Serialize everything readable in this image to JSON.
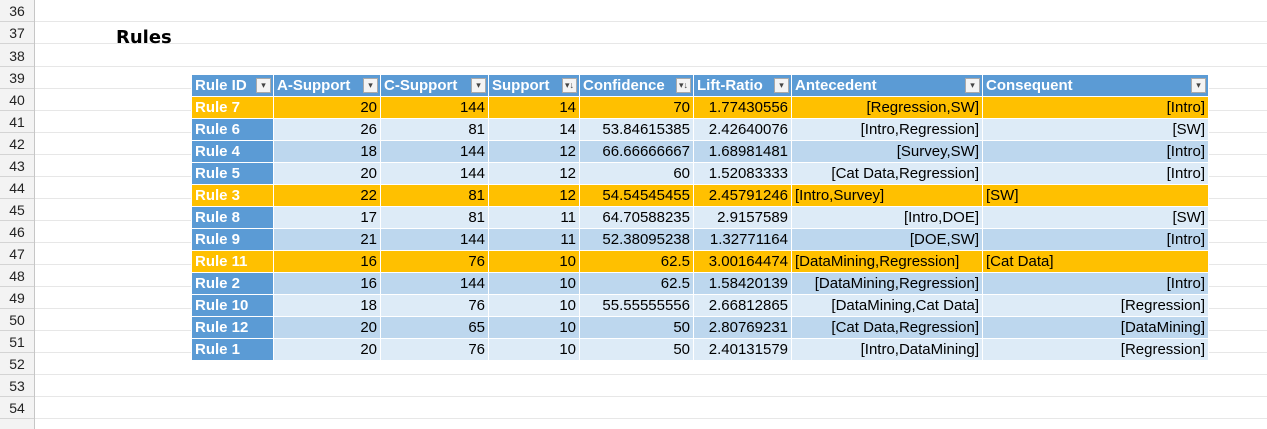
{
  "sheet": {
    "row_numbers": [
      "36",
      "37",
      "38",
      "39",
      "40",
      "41",
      "42",
      "43",
      "44",
      "45",
      "46",
      "47",
      "48",
      "49",
      "50",
      "51",
      "52",
      "53",
      "54"
    ],
    "section_title": "Rules"
  },
  "table": {
    "headers": [
      "Rule ID",
      "A-Support",
      "C-Support",
      "Support",
      "Confidence",
      "Lift-Ratio",
      "Antecedent",
      "Consequent"
    ],
    "dropdown_glyphs": [
      "▾",
      "▾",
      "▾",
      "▾↓",
      "▾↓",
      "▾",
      "▾",
      "▾"
    ],
    "rows": [
      {
        "id": "Rule 7",
        "a": "20",
        "c": "144",
        "s": "14",
        "conf": "70",
        "lift": "1.77430556",
        "ant": "[Regression,SW]",
        "con": "[Intro]",
        "hl": true,
        "ant_align": "r",
        "con_align": "r"
      },
      {
        "id": "Rule 6",
        "a": "26",
        "c": "81",
        "s": "14",
        "conf": "53.84615385",
        "lift": "2.42640076",
        "ant": "[Intro,Regression]",
        "con": "[SW]",
        "hl": false,
        "ant_align": "r",
        "con_align": "r"
      },
      {
        "id": "Rule 4",
        "a": "18",
        "c": "144",
        "s": "12",
        "conf": "66.66666667",
        "lift": "1.68981481",
        "ant": "[Survey,SW]",
        "con": "[Intro]",
        "hl": false,
        "ant_align": "r",
        "con_align": "r"
      },
      {
        "id": "Rule 5",
        "a": "20",
        "c": "144",
        "s": "12",
        "conf": "60",
        "lift": "1.52083333",
        "ant": "[Cat Data,Regression]",
        "con": "[Intro]",
        "hl": false,
        "ant_align": "r",
        "con_align": "r"
      },
      {
        "id": "Rule 3",
        "a": "22",
        "c": "81",
        "s": "12",
        "conf": "54.54545455",
        "lift": "2.45791246",
        "ant": "[Intro,Survey]",
        "con": "[SW]",
        "hl": true,
        "ant_align": "l",
        "con_align": "l"
      },
      {
        "id": "Rule 8",
        "a": "17",
        "c": "81",
        "s": "11",
        "conf": "64.70588235",
        "lift": "2.9157589",
        "ant": "[Intro,DOE]",
        "con": "[SW]",
        "hl": false,
        "ant_align": "r",
        "con_align": "r"
      },
      {
        "id": "Rule 9",
        "a": "21",
        "c": "144",
        "s": "11",
        "conf": "52.38095238",
        "lift": "1.32771164",
        "ant": "[DOE,SW]",
        "con": "[Intro]",
        "hl": false,
        "ant_align": "r",
        "con_align": "r"
      },
      {
        "id": "Rule 11",
        "a": "16",
        "c": "76",
        "s": "10",
        "conf": "62.5",
        "lift": "3.00164474",
        "ant": "[DataMining,Regression]",
        "con": "[Cat Data]",
        "hl": true,
        "ant_align": "l",
        "con_align": "l"
      },
      {
        "id": "Rule 2",
        "a": "16",
        "c": "144",
        "s": "10",
        "conf": "62.5",
        "lift": "1.58420139",
        "ant": "[DataMining,Regression]",
        "con": "[Intro]",
        "hl": false,
        "ant_align": "r",
        "con_align": "r"
      },
      {
        "id": "Rule 10",
        "a": "18",
        "c": "76",
        "s": "10",
        "conf": "55.55555556",
        "lift": "2.66812865",
        "ant": "[DataMining,Cat Data]",
        "con": "[Regression]",
        "hl": false,
        "ant_align": "r",
        "con_align": "r"
      },
      {
        "id": "Rule 12",
        "a": "20",
        "c": "65",
        "s": "10",
        "conf": "50",
        "lift": "2.80769231",
        "ant": "[Cat Data,Regression]",
        "con": "[DataMining]",
        "hl": false,
        "ant_align": "r",
        "con_align": "r"
      },
      {
        "id": "Rule 1",
        "a": "20",
        "c": "76",
        "s": "10",
        "conf": "50",
        "lift": "2.40131579",
        "ant": "[Intro,DataMining]",
        "con": "[Regression]",
        "hl": false,
        "ant_align": "r",
        "con_align": "r"
      }
    ]
  },
  "colors": {
    "header": "#5b9bd5",
    "band_light": "#ddebf7",
    "band_dark": "#bdd7ee",
    "highlight": "#ffc000"
  }
}
